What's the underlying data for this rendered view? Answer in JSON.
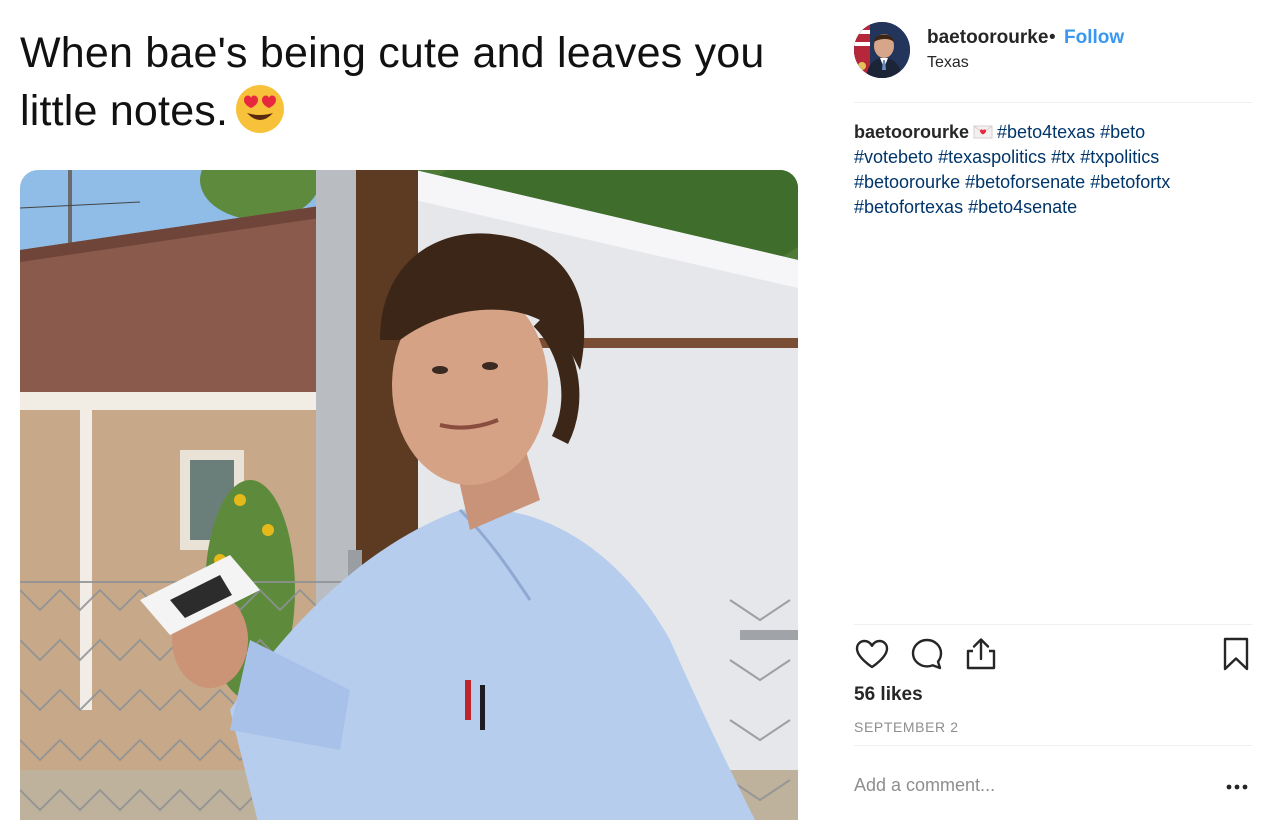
{
  "post_media": {
    "caption_text": "When bae's being cute and leaves you little notes.",
    "emoji": "heart-eyes-emoji"
  },
  "header": {
    "username": "baetoorourke",
    "separator": "•",
    "follow_label": "Follow",
    "location": "Texas"
  },
  "caption": {
    "username": "baetoorourke",
    "emoji": "heart-letter-emoji",
    "hashtags": [
      "#beto4texas",
      "#beto",
      "#votebeto",
      "#texaspolitics",
      "#tx",
      "#txpolitics",
      "#betoorourke",
      "#betoforsenate",
      "#betofortx",
      "#betofortexas",
      "#beto4senate"
    ]
  },
  "actions": {
    "icons": [
      "heart-icon",
      "comment-icon",
      "share-icon",
      "bookmark-icon"
    ]
  },
  "likes": "56 likes",
  "date": "SEPTEMBER 2",
  "comment": {
    "placeholder": "Add a comment...",
    "more": "more-options-icon"
  },
  "colors": {
    "link": "#3897f0",
    "hashtag": "#003569",
    "muted": "#8e8e8e",
    "divider": "#efefef"
  }
}
